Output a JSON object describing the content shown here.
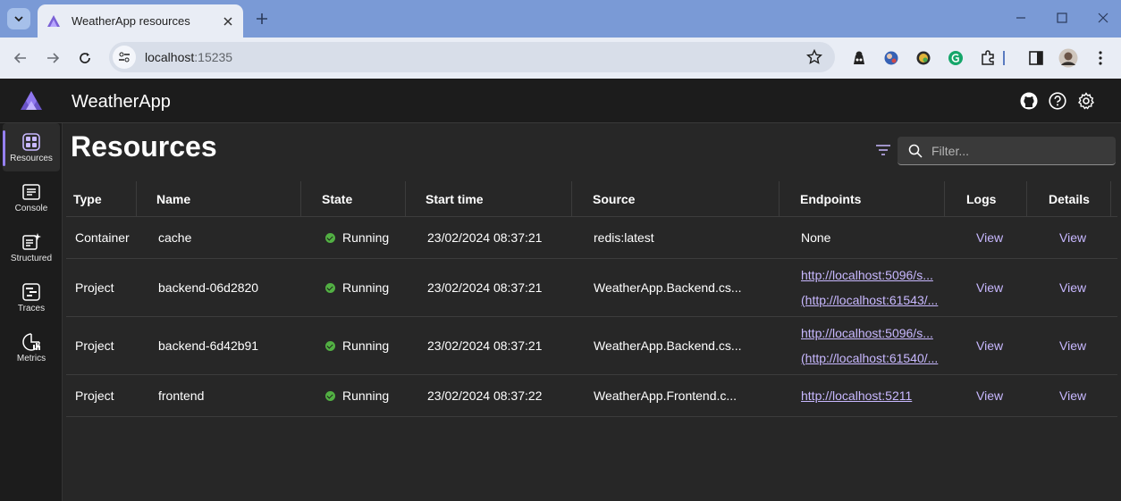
{
  "browser": {
    "tab_title": "WeatherApp resources",
    "url_host": "localhost",
    "url_port": ":15235"
  },
  "app": {
    "name": "WeatherApp",
    "brand_color": "#9580f0"
  },
  "sidebar": {
    "items": [
      {
        "label": "Resources",
        "icon": "grid-icon"
      },
      {
        "label": "Console",
        "icon": "console-icon"
      },
      {
        "label": "Structured",
        "icon": "structured-logs-icon"
      },
      {
        "label": "Traces",
        "icon": "traces-icon"
      },
      {
        "label": "Metrics",
        "icon": "metrics-icon"
      }
    ]
  },
  "page": {
    "title": "Resources",
    "filter_placeholder": "Filter..."
  },
  "table": {
    "headers": {
      "type": "Type",
      "name": "Name",
      "state": "State",
      "start": "Start time",
      "source": "Source",
      "endpoints": "Endpoints",
      "logs": "Logs",
      "details": "Details"
    },
    "rows": [
      {
        "type": "Container",
        "name": "cache",
        "state": "Running",
        "start": "23/02/2024 08:37:21",
        "source": "redis:latest",
        "endpoint1": "None",
        "endpoint2": "",
        "logs": "View",
        "details": "View"
      },
      {
        "type": "Project",
        "name": "backend-06d2820",
        "state": "Running",
        "start": "23/02/2024 08:37:21",
        "source": "WeatherApp.Backend.cs...",
        "endpoint1": "http://localhost:5096/s...",
        "endpoint2": "(http://localhost:61543/...",
        "logs": "View",
        "details": "View"
      },
      {
        "type": "Project",
        "name": "backend-6d42b91",
        "state": "Running",
        "start": "23/02/2024 08:37:21",
        "source": "WeatherApp.Backend.cs...",
        "endpoint1": "http://localhost:5096/s...",
        "endpoint2": "(http://localhost:61540/...",
        "logs": "View",
        "details": "View"
      },
      {
        "type": "Project",
        "name": "frontend",
        "state": "Running",
        "start": "23/02/2024 08:37:22",
        "source": "WeatherApp.Frontend.c...",
        "endpoint1": "http://localhost:5211",
        "endpoint2": "",
        "logs": "View",
        "details": "View"
      }
    ]
  }
}
